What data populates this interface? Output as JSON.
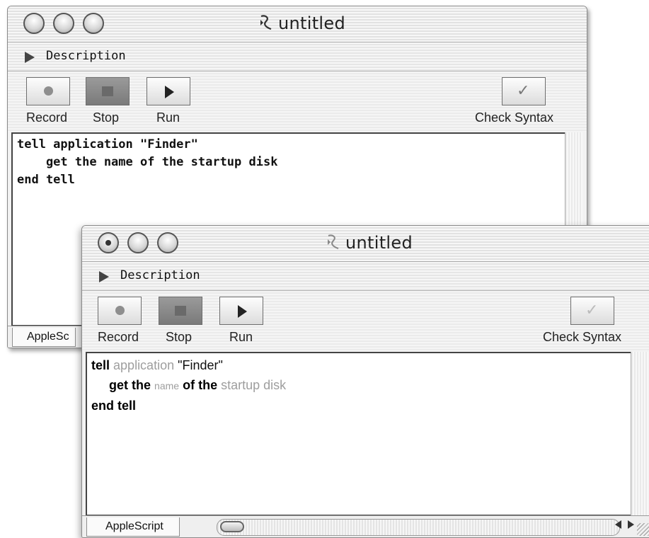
{
  "back_window": {
    "title": "untitled",
    "description_label": "Description",
    "toolbar": {
      "record": "Record",
      "stop": "Stop",
      "run": "Run",
      "check_syntax": "Check Syntax"
    },
    "code_lines": [
      "tell application \"Finder\"",
      "    get the name of the startup disk",
      "end tell"
    ],
    "language": "AppleSc"
  },
  "front_window": {
    "title": "untitled",
    "description_label": "Description",
    "toolbar": {
      "record": "Record",
      "stop": "Stop",
      "run": "Run",
      "check_syntax": "Check Syntax"
    },
    "code": {
      "line1": {
        "kw": "tell",
        "app": "application",
        "str": "\"Finder\""
      },
      "line2": {
        "kw1": "get the",
        "name": "name",
        "kw2": "of the",
        "rest": "startup disk"
      },
      "line3": {
        "kw": "end tell"
      }
    },
    "language": "AppleScript"
  }
}
